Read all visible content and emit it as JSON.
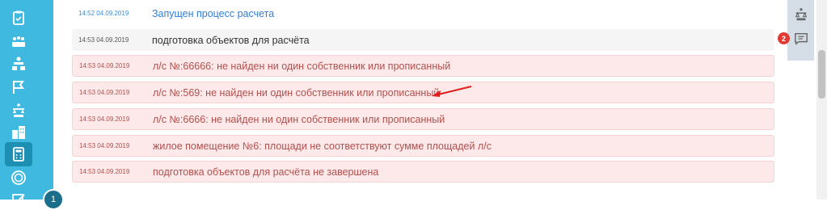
{
  "sidebar": {
    "icons": [
      "clipboard-icon",
      "people-growth-icon",
      "org-chart-icon",
      "flag-icon",
      "scale-icon",
      "buildings-icon",
      "calculator-icon",
      "currency-icon",
      "edit-icon"
    ],
    "badge": "1"
  },
  "log": {
    "rows": [
      {
        "time": "14:52 04.09.2019",
        "message": "Запущен процесс расчета",
        "type": "info"
      },
      {
        "time": "14:53 04.09.2019",
        "message": "подготовка объектов для расчёта",
        "type": "neutral"
      },
      {
        "time": "14:53 04.09.2019",
        "message": "л/с №:66666: не найден ни один собственник или прописанный",
        "type": "error"
      },
      {
        "time": "14:53 04.09.2019",
        "message": "л/с №:569: не найден ни один собственник или прописанный",
        "type": "error"
      },
      {
        "time": "14:53 04.09.2019",
        "message": "л/с №:6666: не найден ни один собственник или прописанный",
        "type": "error"
      },
      {
        "time": "14:53 04.09.2019",
        "message": "жилое помещение №6: площади не соответствуют сумме площадей л/с",
        "type": "error"
      },
      {
        "time": "14:53 04.09.2019",
        "message": "подготовка объектов для расчёта не завершена",
        "type": "error"
      }
    ]
  },
  "right_panel": {
    "icons": [
      "scale-icon",
      "chat-icon"
    ],
    "chat_badge": "2"
  },
  "colors": {
    "sidebar": "#3fb9e0",
    "error_text": "#b0504d",
    "info_text": "#2f7fd6",
    "arrow": "#e02020"
  }
}
